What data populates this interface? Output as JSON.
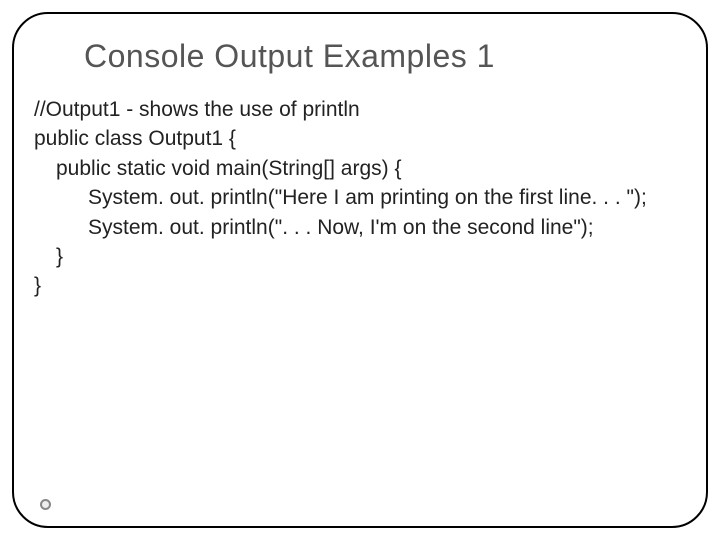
{
  "slide": {
    "title": "Console Output Examples 1",
    "code": {
      "line1": "//Output1 - shows the use of println",
      "line2": "public class Output1 {",
      "line3": "public static void main(String[] args) {",
      "line4": "System. out. println(\"Here I am printing on the first line. . . \");",
      "line5": "System. out. println(\". . . Now, I'm on the second line\");",
      "line6": "}",
      "line7": "}"
    }
  }
}
